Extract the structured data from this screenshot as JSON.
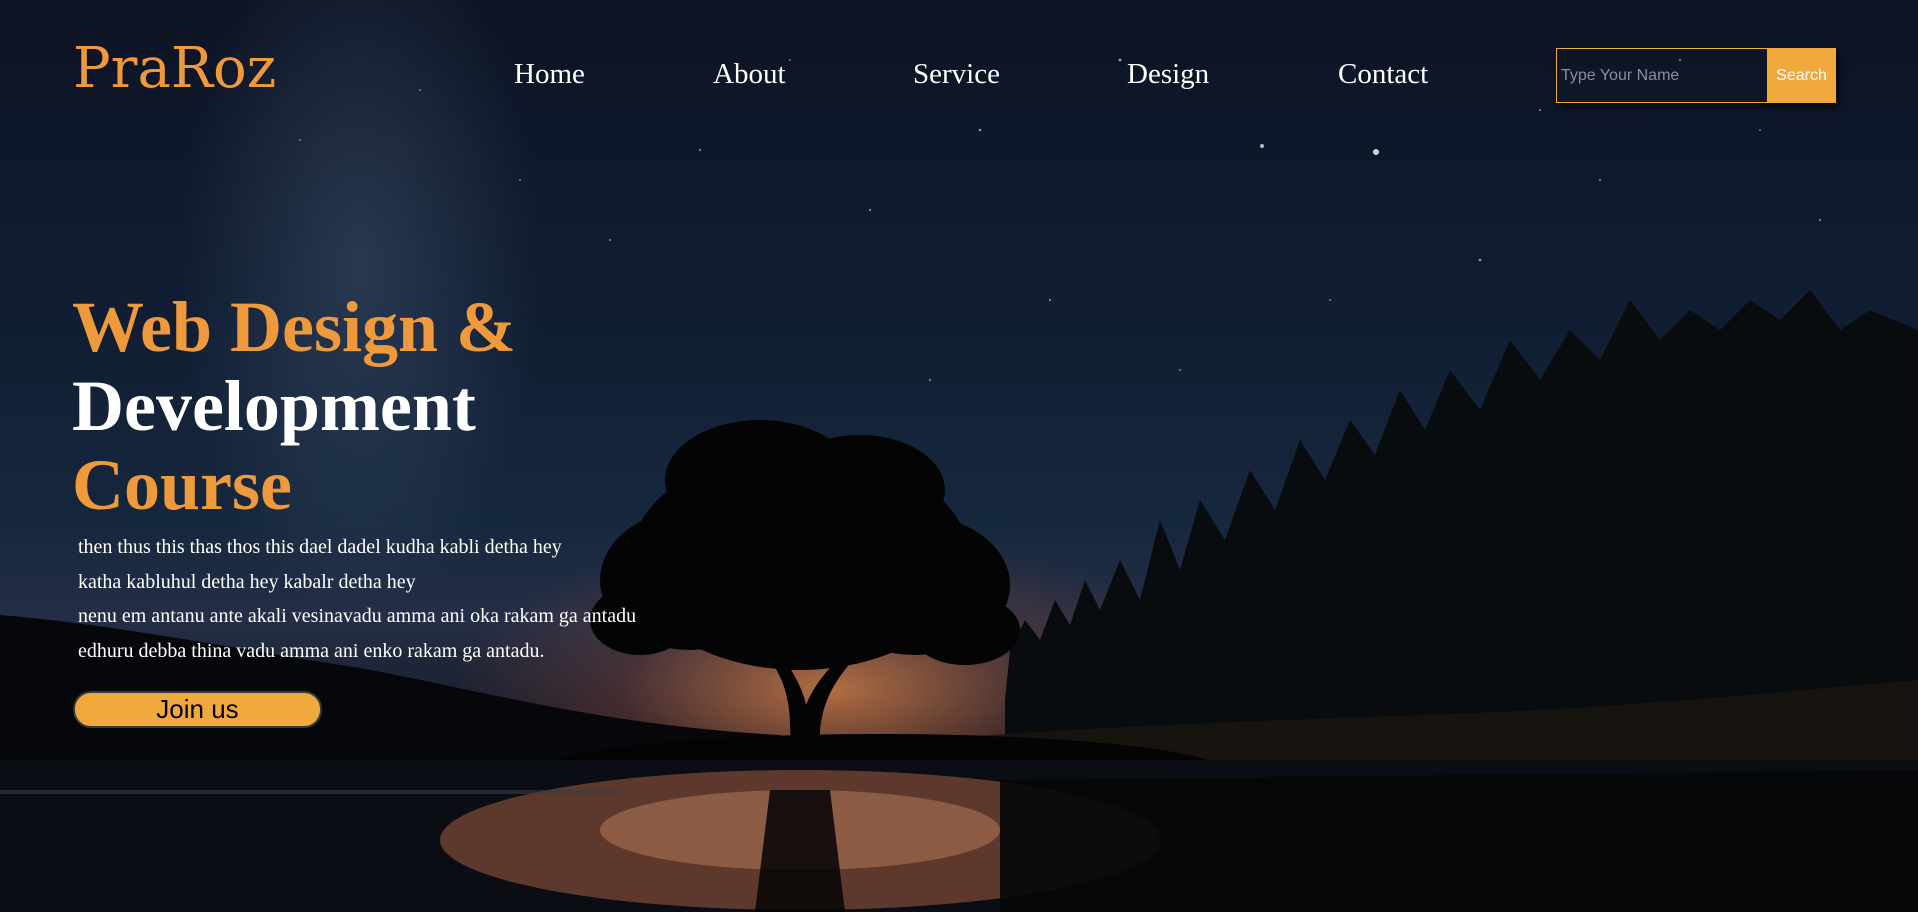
{
  "brand": {
    "logo": "PraRoz"
  },
  "nav": {
    "items": [
      "Home",
      "About",
      "Service",
      "Design",
      "Contact"
    ]
  },
  "search": {
    "placeholder": "Type Your Name",
    "value": "",
    "button_label": "Search"
  },
  "hero": {
    "title_line1": "Web Design &",
    "title_line2": "Development",
    "title_line3": "Course",
    "paragraph_lines": [
      "then thus this thas thos this dael dadel kudha kabli detha hey",
      "katha kabluhul detha hey kabalr detha hey",
      "nenu em antanu ante akali vesinavadu amma ani oka rakam ga antadu",
      "edhuru debba thina vadu amma ani enko rakam ga antadu."
    ],
    "cta_label": "Join us"
  },
  "colors": {
    "accent": "#ee9a3c",
    "button": "#f0a93c",
    "text": "#ffffff"
  }
}
